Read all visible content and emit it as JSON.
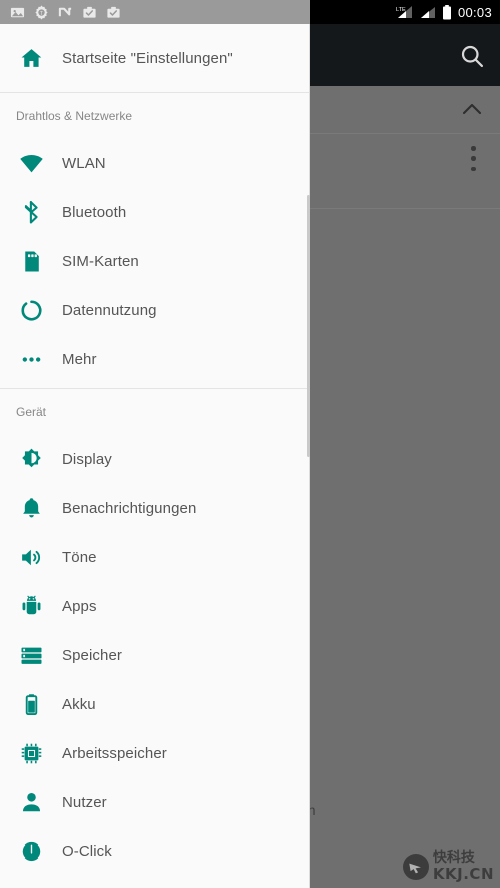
{
  "status_bar": {
    "time": "00:03",
    "network_label": "LTE",
    "left_icons": [
      "image-icon",
      "settings-gear-icon",
      "n-logo-icon",
      "work-badge-icon",
      "work-badge-icon"
    ],
    "right_icons": [
      "lte-signal-icon",
      "signal-icon",
      "battery-icon"
    ]
  },
  "background_app": {
    "search_icon": "search-icon",
    "collapse_icon": "chevron-up-icon",
    "overflow_icon": "more-vert-icon",
    "partial_text": "en"
  },
  "drawer": {
    "header": {
      "label": "Startseite \"Einstellungen\"",
      "icon": "home-icon"
    },
    "sections": [
      {
        "title": "Drahtlos & Netzwerke",
        "items": [
          {
            "label": "WLAN",
            "icon": "wifi-icon"
          },
          {
            "label": "Bluetooth",
            "icon": "bluetooth-icon"
          },
          {
            "label": "SIM-Karten",
            "icon": "sim-card-icon"
          },
          {
            "label": "Datennutzung",
            "icon": "data-usage-icon"
          },
          {
            "label": "Mehr",
            "icon": "more-horiz-icon"
          }
        ]
      },
      {
        "title": "Gerät",
        "items": [
          {
            "label": "Display",
            "icon": "brightness-icon"
          },
          {
            "label": "Benachrichtigungen",
            "icon": "bell-icon"
          },
          {
            "label": "Töne",
            "icon": "volume-icon"
          },
          {
            "label": "Apps",
            "icon": "android-icon"
          },
          {
            "label": "Speicher",
            "icon": "storage-icon"
          },
          {
            "label": "Akku",
            "icon": "battery-icon"
          },
          {
            "label": "Arbeitsspeicher",
            "icon": "memory-chip-icon"
          },
          {
            "label": "Nutzer",
            "icon": "person-icon"
          },
          {
            "label": "O-Click",
            "icon": "o-click-icon"
          }
        ]
      }
    ]
  },
  "watermark": {
    "zh": "快科技",
    "cn": "KKJ.CN"
  },
  "colors": {
    "accent": "#00897b",
    "drawer_bg": "#fafafa",
    "scrim": "#6f6f6f",
    "toolbar": "#14181a"
  }
}
